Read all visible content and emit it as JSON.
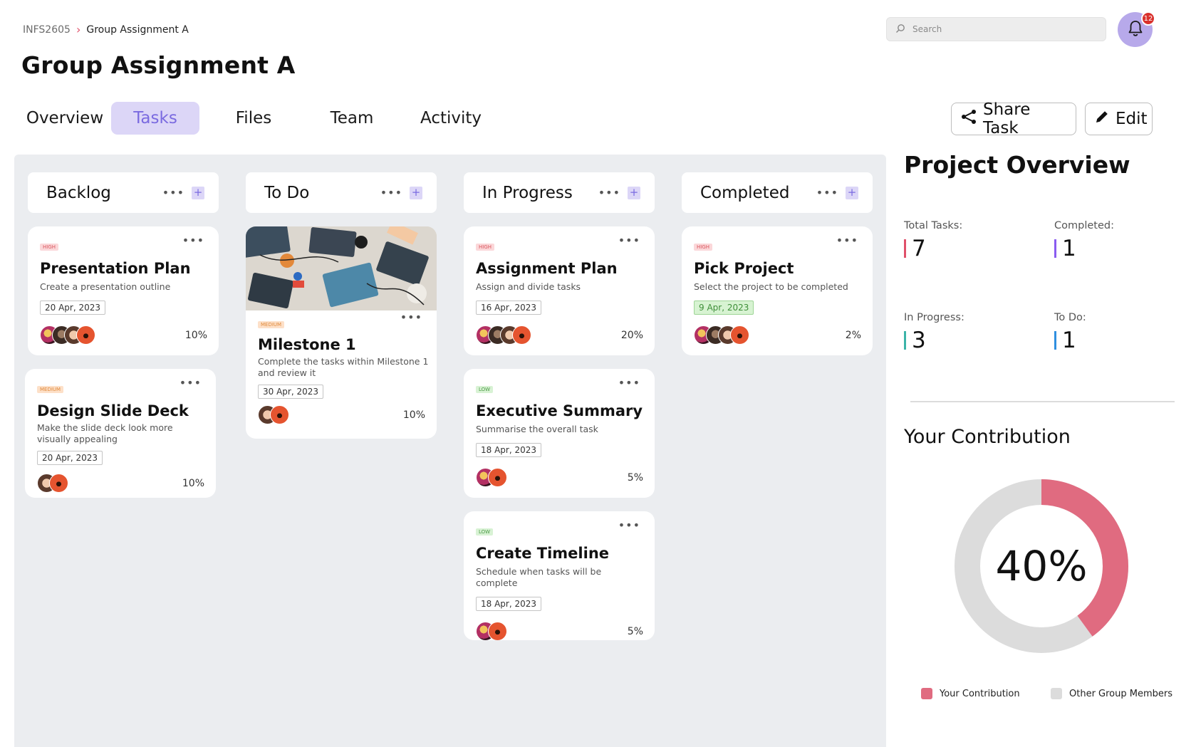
{
  "breadcrumb": {
    "parent": "INFS2605",
    "current": "Group Assignment A"
  },
  "page_title": "Group Assignment A",
  "search": {
    "placeholder": "Search"
  },
  "notifications": {
    "count": "12"
  },
  "tabs": [
    {
      "label": "Overview",
      "active": false
    },
    {
      "label": "Tasks",
      "active": true
    },
    {
      "label": "Files",
      "active": false
    },
    {
      "label": "Team",
      "active": false
    },
    {
      "label": "Activity",
      "active": false
    }
  ],
  "actions": {
    "share": "Share Task",
    "edit": "Edit"
  },
  "columns": [
    {
      "name": "Backlog",
      "cards": [
        {
          "priority": "HIGH",
          "title": "Presentation Plan",
          "desc": "Create a presentation outline",
          "date": "20 Apr, 2023",
          "pct": "10%",
          "avatars": 4
        },
        {
          "priority": "MEDIUM",
          "title": "Design Slide Deck",
          "desc": "Make the slide deck look more visually appealing",
          "date": "20 Apr, 2023",
          "pct": "10%",
          "avatars": 2
        }
      ]
    },
    {
      "name": "To Do",
      "cards": [
        {
          "priority": "MEDIUM",
          "title": "Milestone 1",
          "desc": "Complete the tasks within Milestone 1 and review it",
          "date": "30 Apr, 2023",
          "pct": "10%",
          "avatars": 2,
          "image": "laptops-on-table"
        }
      ]
    },
    {
      "name": "In Progress",
      "cards": [
        {
          "priority": "HIGH",
          "title": "Assignment Plan",
          "desc": "Assign and divide tasks",
          "date": "16 Apr, 2023",
          "pct": "20%",
          "avatars": 4
        },
        {
          "priority": "LOW",
          "title": "Executive Summary",
          "desc": "Summarise the overall task",
          "date": "18 Apr, 2023",
          "pct": "5%",
          "avatars": 2
        },
        {
          "priority": "LOW",
          "title": "Create Timeline",
          "desc": "Schedule when tasks will be complete",
          "date": "18 Apr, 2023",
          "pct": "5%",
          "avatars": 2
        }
      ]
    },
    {
      "name": "Completed",
      "cards": [
        {
          "priority": "HIGH",
          "title": "Pick Project",
          "desc": "Select the project to be completed",
          "date": "9 Apr, 2023",
          "date_style": "green",
          "pct": "2%",
          "avatars": 4
        }
      ]
    }
  ],
  "overview": {
    "title": "Project Overview",
    "stats": [
      {
        "label": "Total Tasks:",
        "value": "7",
        "color": "#e0506a"
      },
      {
        "label": "Completed:",
        "value": "1",
        "color": "#8a5cf0"
      },
      {
        "label": "In Progress:",
        "value": "3",
        "color": "#3bb3a8"
      },
      {
        "label": "To Do:",
        "value": "1",
        "color": "#2f8fe0"
      }
    ],
    "contribution": {
      "title": "Your Contribution",
      "percent_label": "40%",
      "percent": 40,
      "your_color": "#e06b80",
      "other_color": "#dcdcdc",
      "legend": [
        "Your Contribution",
        "Other Group Members"
      ]
    }
  }
}
